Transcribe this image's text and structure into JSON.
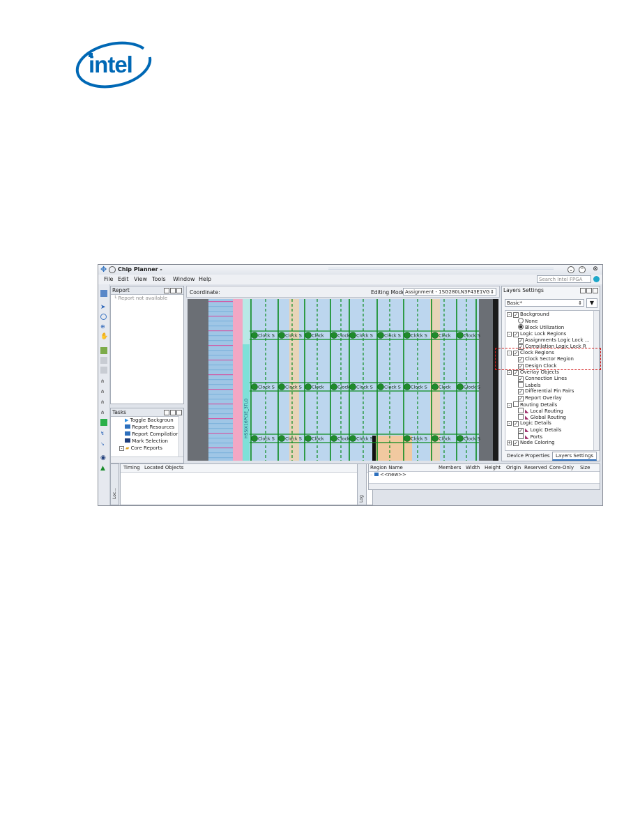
{
  "logo": {
    "text": "intel",
    "icon": "intel-logo-icon",
    "color": "#0068b5"
  },
  "window": {
    "title": "Chip Planner -",
    "controls": [
      "minimize-icon",
      "maximize-icon",
      "close-icon"
    ],
    "menu": [
      "File",
      "Edit",
      "View",
      "Tools",
      "Window",
      "Help"
    ],
    "search_placeholder": "Search Intel FPGA"
  },
  "report_panel": {
    "title": "Report",
    "empty_text": "Report not available"
  },
  "tasks_panel": {
    "title": "Tasks",
    "items": [
      "Toggle Backgroun",
      "Report Resources",
      "Report Compilatior",
      "Mark Selection",
      "Core Reports"
    ]
  },
  "canvas": {
    "coordinate_label": "Coordinate:",
    "editing_mode_label": "Editing Mode:",
    "editing_mode_value": "Assignment - 1SG280LN3F43E1VG",
    "clock_label": "Clock S",
    "clock_label_short": "Clock",
    "vertical_label": "HSSIX16PCIE_3TLO"
  },
  "layers_panel": {
    "title": "Layers Settings",
    "preset": "Basic*",
    "tree": [
      {
        "label": "Background",
        "level": 0,
        "type": "check",
        "checked": true,
        "expander": "-"
      },
      {
        "label": "None",
        "level": 1,
        "type": "radio",
        "checked": false
      },
      {
        "label": "Block Utilization",
        "level": 1,
        "type": "radio",
        "checked": true
      },
      {
        "label": "Logic Lock Regions",
        "level": 0,
        "type": "check",
        "checked": true,
        "expander": "-"
      },
      {
        "label": "Assignments Logic Lock ...",
        "level": 1,
        "type": "check",
        "checked": true
      },
      {
        "label": "Compilation Logic Lock R",
        "level": 1,
        "type": "check",
        "checked": true
      },
      {
        "label": "Clock Regions",
        "level": 0,
        "type": "check",
        "checked": true,
        "expander": "-"
      },
      {
        "label": "Clock Sector Region",
        "level": 1,
        "type": "check",
        "checked": true
      },
      {
        "label": "Design Clock",
        "level": 1,
        "type": "check",
        "checked": true
      },
      {
        "label": "Overlay Objects",
        "level": 0,
        "type": "check",
        "checked": true,
        "expander": "-"
      },
      {
        "label": "Connection Lines",
        "level": 1,
        "type": "check",
        "checked": true
      },
      {
        "label": "Labels",
        "level": 1,
        "type": "check",
        "checked": false
      },
      {
        "label": "Differential Pin Pairs",
        "level": 1,
        "type": "check",
        "checked": true
      },
      {
        "label": "Report Overlay",
        "level": 1,
        "type": "check",
        "checked": true
      },
      {
        "label": "Routing Details",
        "level": 0,
        "type": "check",
        "checked": false,
        "expander": "-"
      },
      {
        "label": "Local Routing",
        "level": 1,
        "type": "check",
        "checked": false,
        "icon": true
      },
      {
        "label": "Global Routing",
        "level": 1,
        "type": "check",
        "checked": false,
        "icon": true
      },
      {
        "label": "Logic Details",
        "level": 0,
        "type": "check",
        "checked": true,
        "expander": "-"
      },
      {
        "label": "Logic Details",
        "level": 1,
        "type": "check",
        "checked": true,
        "icon": true
      },
      {
        "label": "Ports",
        "level": 1,
        "type": "check",
        "checked": false,
        "icon": true
      },
      {
        "label": "Node Coloring",
        "level": 0,
        "type": "check",
        "checked": true,
        "expander": "+"
      }
    ],
    "tabs": [
      "Device Properties",
      "Layers Settings"
    ],
    "active_tab": "Layers Settings"
  },
  "bottom_left": {
    "tabs": [
      "Timing",
      "Located Objects"
    ],
    "side_label": "Loc..."
  },
  "bottom_right": {
    "side_label": "Log",
    "columns": [
      "Region Name",
      "Members",
      "Width",
      "Height",
      "Origin",
      "Reserved",
      "Core-Only",
      "Size"
    ],
    "rows": [
      [
        "<<new>>",
        "",
        "",
        "",
        "",
        "",
        "",
        ""
      ]
    ]
  },
  "colors": {
    "accent": "#1ea7c9",
    "clock_green": "#1f8a2b",
    "clock_line": "#0b8c1f",
    "canvas_fill": "#c9dcef",
    "highlight": "#d32020"
  }
}
